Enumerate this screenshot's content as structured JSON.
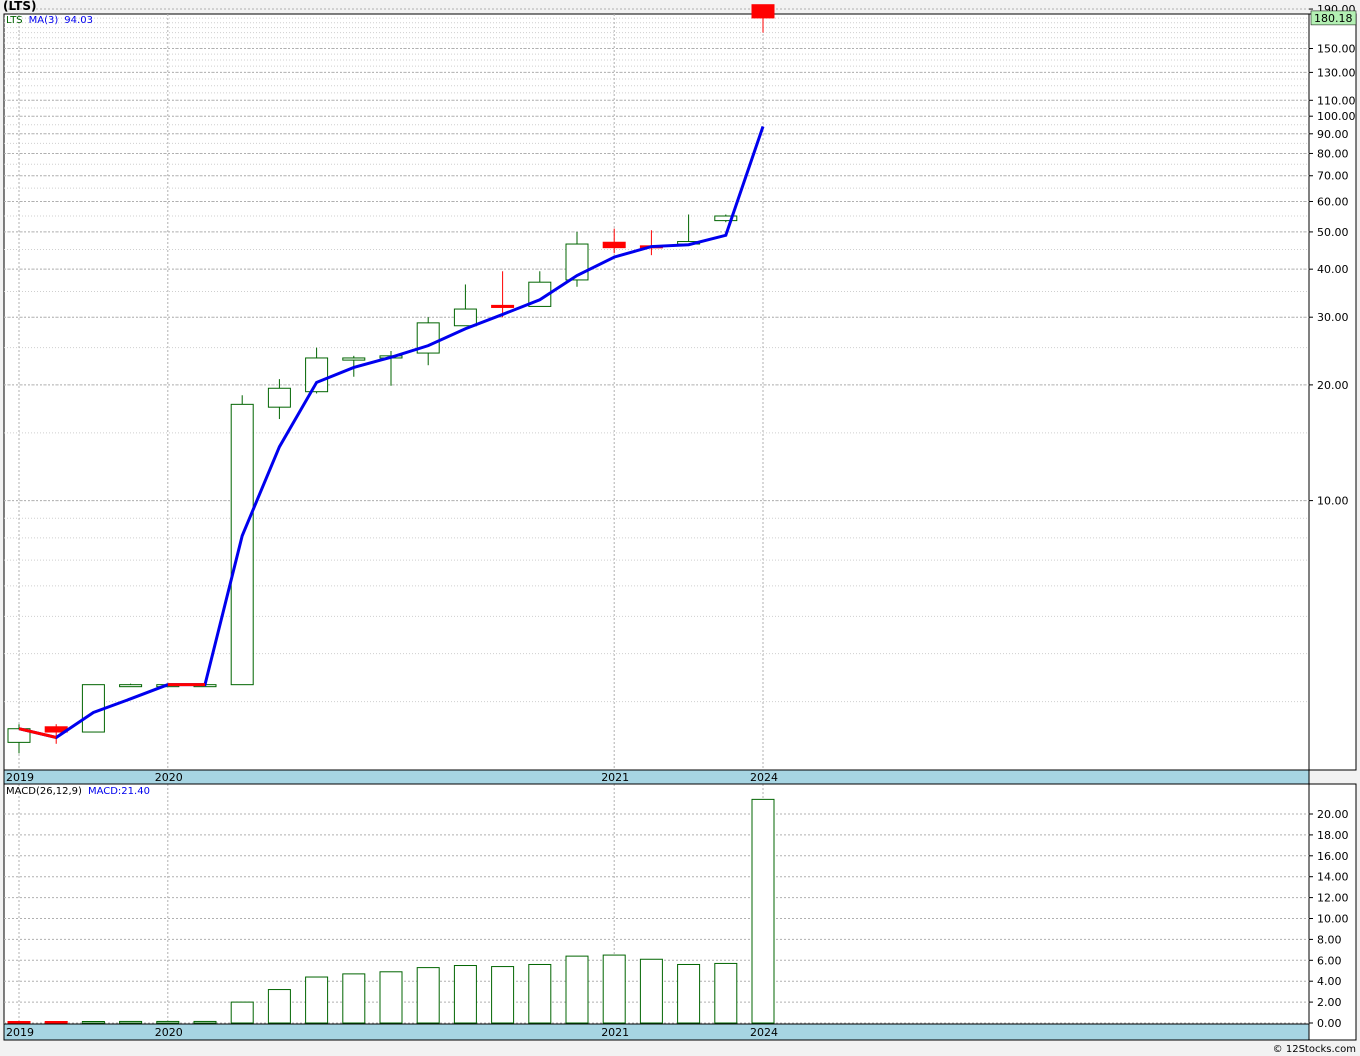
{
  "header": {
    "title": "(LTS)",
    "legend_ticker": "LTS",
    "legend_ma_label": "MA(3)",
    "legend_ma_value": "94.03",
    "macd_label": "MACD(26,12,9)",
    "macd_value_label": "MACD:21.40"
  },
  "footer": {
    "credit": "© 12Stocks.com"
  },
  "colors": {
    "up": "#006400",
    "down": "#ff0000",
    "ma": "#0000ee",
    "date_band": "#a7d5e3",
    "last_price_bg": "#b3f0b3",
    "grid": "#b0b0b0"
  },
  "chart_data": [
    {
      "type": "candlestick",
      "title": "(LTS)",
      "y_scale": "log",
      "ylim": [
        2.1,
        230
      ],
      "y_ticks": [
        10,
        20,
        30,
        40,
        50,
        60,
        70,
        80,
        90,
        100,
        110,
        130,
        150,
        190
      ],
      "y_tick_labels": [
        "10.00",
        "20.00",
        "30.00",
        "40.00",
        "50.00",
        "60.00",
        "70.00",
        "80.00",
        "90.00",
        "100.00",
        "110.00",
        "130.00",
        "150.00",
        "190.00"
      ],
      "last_price_label": "180.18",
      "last_price": 180.18,
      "x_labels": [
        {
          "index": 0,
          "label": "2019"
        },
        {
          "index": 4,
          "label": "2020"
        },
        {
          "index": 16,
          "label": "2021"
        },
        {
          "index": 20,
          "label": "2024"
        }
      ],
      "candles": [
        {
          "open": 2.35,
          "high": 2.62,
          "low": 2.2,
          "close": 2.55
        },
        {
          "open": 2.58,
          "high": 2.62,
          "low": 2.33,
          "close": 2.5
        },
        {
          "open": 2.5,
          "high": 3.32,
          "low": 2.5,
          "close": 3.32
        },
        {
          "open": 3.32,
          "high": 3.34,
          "low": 3.3,
          "close": 3.32
        },
        {
          "open": 3.32,
          "high": 3.34,
          "low": 3.3,
          "close": 3.32
        },
        {
          "open": 3.32,
          "high": 3.34,
          "low": 3.3,
          "close": 3.32
        },
        {
          "open": 3.32,
          "high": 18.8,
          "low": 3.32,
          "close": 17.8
        },
        {
          "open": 17.5,
          "high": 20.7,
          "low": 16.3,
          "close": 19.6
        },
        {
          "open": 19.2,
          "high": 25.0,
          "low": 19.0,
          "close": 23.5
        },
        {
          "open": 23.2,
          "high": 23.8,
          "low": 21.0,
          "close": 23.5
        },
        {
          "open": 23.5,
          "high": 24.5,
          "low": 19.9,
          "close": 23.8
        },
        {
          "open": 24.2,
          "high": 30.0,
          "low": 22.5,
          "close": 29.0
        },
        {
          "open": 28.5,
          "high": 36.5,
          "low": 28.5,
          "close": 31.5
        },
        {
          "open": 32.2,
          "high": 39.5,
          "low": 30.0,
          "close": 31.8
        },
        {
          "open": 32.0,
          "high": 39.5,
          "low": 32.0,
          "close": 37.0
        },
        {
          "open": 37.5,
          "high": 50.0,
          "low": 36.0,
          "close": 46.5
        },
        {
          "open": 47.0,
          "high": 51.0,
          "low": 44.0,
          "close": 45.5
        },
        {
          "open": 46.0,
          "high": 50.5,
          "low": 43.5,
          "close": 45.8
        },
        {
          "open": 46.5,
          "high": 55.5,
          "low": 46.0,
          "close": 47.2
        },
        {
          "open": 53.5,
          "high": 55.5,
          "low": 53.0,
          "close": 55.0
        },
        {
          "open": 195.0,
          "high": 195.0,
          "low": 165.0,
          "close": 180.18
        }
      ],
      "ma_series": {
        "name": "MA(3)",
        "values": [
          2.55,
          2.42,
          2.81,
          3.05,
          3.32,
          3.32,
          8.1,
          13.8,
          20.3,
          22.2,
          23.6,
          25.3,
          28.0,
          30.5,
          33.3,
          38.5,
          43.0,
          45.8,
          46.3,
          49.0,
          94.03
        ],
        "down_segments": [
          [
            0,
            1
          ],
          [
            4,
            5
          ]
        ]
      }
    },
    {
      "type": "bar",
      "title": "MACD(26,12,9)",
      "ylim": [
        -0.2,
        22
      ],
      "y_ticks": [
        0,
        2,
        4,
        6,
        8,
        10,
        12,
        14,
        16,
        18,
        20
      ],
      "y_tick_labels": [
        "0.00",
        "2.00",
        "4.00",
        "6.00",
        "8.00",
        "10.00",
        "12.00",
        "14.00",
        "16.00",
        "18.00",
        "20.00"
      ],
      "values": [
        0.1,
        0.1,
        0.08,
        0.15,
        0.15,
        0.15,
        2.0,
        3.2,
        4.4,
        4.7,
        4.9,
        5.3,
        5.5,
        5.4,
        5.6,
        6.4,
        6.5,
        6.1,
        5.6,
        5.7,
        21.4
      ],
      "bar_colors": [
        "down",
        "down",
        "up",
        "up",
        "up",
        "up",
        "up",
        "up",
        "up",
        "up",
        "up",
        "up",
        "up",
        "up",
        "up",
        "up",
        "up",
        "up",
        "up",
        "up",
        "up"
      ]
    }
  ]
}
